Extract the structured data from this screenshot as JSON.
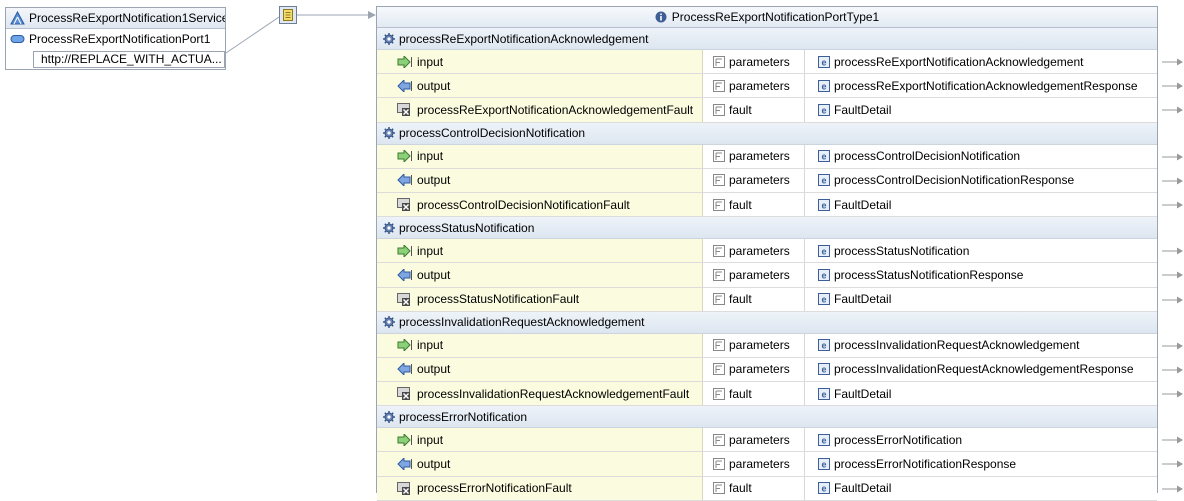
{
  "service": {
    "name": "ProcessReExportNotification1Service",
    "port": "ProcessReExportNotificationPort1",
    "endpoint": "http://REPLACE_WITH_ACTUA..."
  },
  "port_type": {
    "name": "ProcessReExportNotificationPortType1"
  },
  "operations": [
    {
      "name": "processReExportNotificationAcknowledgement",
      "messages": [
        {
          "kind": "input",
          "label": "input",
          "part": "parameters",
          "element": "processReExportNotificationAcknowledgement"
        },
        {
          "kind": "output",
          "label": "output",
          "part": "parameters",
          "element": "processReExportNotificationAcknowledgementResponse"
        },
        {
          "kind": "fault",
          "label": "processReExportNotificationAcknowledgementFault",
          "part": "fault",
          "element": "FaultDetail"
        }
      ]
    },
    {
      "name": "processControlDecisionNotification",
      "messages": [
        {
          "kind": "input",
          "label": "input",
          "part": "parameters",
          "element": "processControlDecisionNotification"
        },
        {
          "kind": "output",
          "label": "output",
          "part": "parameters",
          "element": "processControlDecisionNotificationResponse"
        },
        {
          "kind": "fault",
          "label": "processControlDecisionNotificationFault",
          "part": "fault",
          "element": "FaultDetail"
        }
      ]
    },
    {
      "name": "processStatusNotification",
      "messages": [
        {
          "kind": "input",
          "label": "input",
          "part": "parameters",
          "element": "processStatusNotification"
        },
        {
          "kind": "output",
          "label": "output",
          "part": "parameters",
          "element": "processStatusNotificationResponse"
        },
        {
          "kind": "fault",
          "label": "processStatusNotificationFault",
          "part": "fault",
          "element": "FaultDetail"
        }
      ]
    },
    {
      "name": "processInvalidationRequestAcknowledgement",
      "messages": [
        {
          "kind": "input",
          "label": "input",
          "part": "parameters",
          "element": "processInvalidationRequestAcknowledgement"
        },
        {
          "kind": "output",
          "label": "output",
          "part": "parameters",
          "element": "processInvalidationRequestAcknowledgementResponse"
        },
        {
          "kind": "fault",
          "label": "processInvalidationRequestAcknowledgementFault",
          "part": "fault",
          "element": "FaultDetail"
        }
      ]
    },
    {
      "name": "processErrorNotification",
      "messages": [
        {
          "kind": "input",
          "label": "input",
          "part": "parameters",
          "element": "processErrorNotification"
        },
        {
          "kind": "output",
          "label": "output",
          "part": "parameters",
          "element": "processErrorNotificationResponse"
        },
        {
          "kind": "fault",
          "label": "processErrorNotificationFault",
          "part": "fault",
          "element": "FaultDetail"
        }
      ]
    }
  ],
  "icons": {
    "service": "service-icon",
    "port": "port-icon",
    "binding": "binding-icon",
    "port_type": "info-icon",
    "operation": "gear-icon",
    "input": "input-arrow-icon",
    "output": "output-arrow-icon",
    "fault": "fault-icon",
    "part": "part-icon",
    "element": "element-e-icon",
    "link": "arrow-right-icon"
  },
  "colors": {
    "message_cell": "#fbfbdf",
    "header_gradient": "#e3eaf3",
    "border": "#9aa5b1"
  }
}
